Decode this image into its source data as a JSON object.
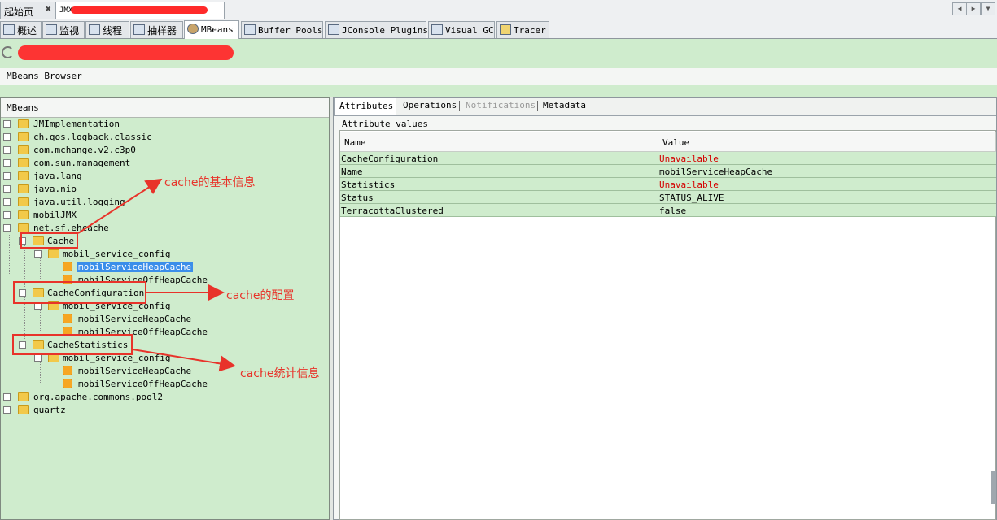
{
  "doc_tabs": [
    {
      "label": "起始页",
      "close": "✖"
    },
    {
      "label": "JMX"
    }
  ],
  "plugin_tabs": [
    "概述",
    "监视",
    "线程",
    "抽样器",
    "MBeans",
    "Buffer Pools",
    "JConsole Plugins",
    "Visual GC",
    "Tracer"
  ],
  "browser_title": "MBeans Browser",
  "tree_title": "MBeans",
  "tree": {
    "n0": "JMImplementation",
    "n1": "ch.qos.logback.classic",
    "n2": "com.mchange.v2.c3p0",
    "n3": "com.sun.management",
    "n4": "java.lang",
    "n5": "java.nio",
    "n6": "java.util.logging",
    "n7": "mobilJMX",
    "n8": "net.sf.ehcache",
    "n9": "Cache",
    "n10": "mobil_service_config",
    "n11": "mobilServiceHeapCache",
    "n12": "mobilServiceOffHeapCache",
    "n13": "CacheConfiguration",
    "n14": "mobil_service_config",
    "n15": "mobilServiceHeapCache",
    "n16": "mobilServiceOffHeapCache",
    "n17": "CacheStatistics",
    "n18": "mobil_service_config",
    "n19": "mobilServiceHeapCache",
    "n20": "mobilServiceOffHeapCache",
    "n21": "org.apache.commons.pool2",
    "n22": "quartz"
  },
  "right_tabs": {
    "attributes": "Attributes",
    "operations": "Operations",
    "notifications": "Notifications",
    "metadata": "Metadata"
  },
  "attribute_values_label": "Attribute values",
  "table": {
    "col_name": "Name",
    "col_value": "Value",
    "rows": [
      {
        "name": "CacheConfiguration",
        "value": "Unavailable"
      },
      {
        "name": "Name",
        "value": "mobilServiceHeapCache"
      },
      {
        "name": "Statistics",
        "value": "Unavailable"
      },
      {
        "name": "Status",
        "value": "STATUS_ALIVE"
      },
      {
        "name": "TerracottaClustered",
        "value": "false"
      }
    ]
  },
  "annotations": {
    "cache_info": "cache的基本信息",
    "cache_config": "cache的配置",
    "cache_stats": "cache统计信息"
  },
  "colors": {
    "accent_red": "#e8332a",
    "panel_green": "#cfeccd",
    "selection_blue": "#3b8eea",
    "unavailable_red": "#d40000"
  },
  "icons": [
    "gear-icon",
    "chart-icon",
    "threads-icon",
    "sampler-icon",
    "beans-icon",
    "buffer-icon",
    "plugin-icon",
    "visualgc-icon",
    "tracer-icon",
    "folder-icon",
    "mbean-icon",
    "spinner-icon"
  ]
}
